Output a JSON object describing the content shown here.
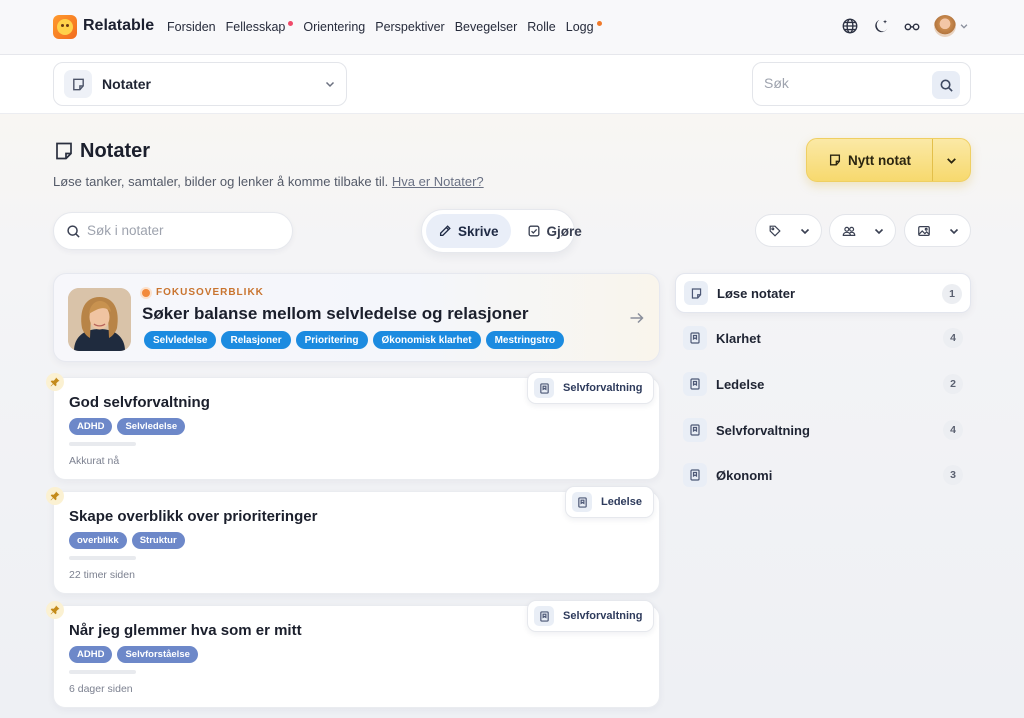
{
  "nav": {
    "brand": "Relatable",
    "links": [
      {
        "label": "Forsiden",
        "dot": ""
      },
      {
        "label": "Fellesskap",
        "dot": "pink"
      },
      {
        "label": "Orientering",
        "dot": ""
      },
      {
        "label": "Perspektiver",
        "dot": ""
      },
      {
        "label": "Bevegelser",
        "dot": ""
      },
      {
        "label": "Rolle",
        "dot": ""
      },
      {
        "label": "Logg",
        "dot": "orange"
      }
    ],
    "icons": [
      "globe-icon",
      "moon-sparkle-icon",
      "glasses-icon"
    ]
  },
  "subheader": {
    "page_select": "Notater",
    "search_placeholder": "Søk"
  },
  "header": {
    "title": "Notater",
    "description": "Løse tanker, samtaler, bilder og lenker å komme tilbake til.",
    "help_link": "Hva er Notater?",
    "new_button": "Nytt notat"
  },
  "filters": {
    "search_placeholder": "Søk i notater",
    "mode_write": "Skrive",
    "mode_do": "Gjøre"
  },
  "focus": {
    "eyebrow": "FOKUSOVERBLIKK",
    "title": "Søker balanse mellom selvledelse og relasjoner",
    "tags": [
      "Selvledelse",
      "Relasjoner",
      "Prioritering",
      "Økonomisk klarhet",
      "Mestringstro"
    ]
  },
  "notes": [
    {
      "title": "God selvforvaltning",
      "tags": [
        "ADHD",
        "Selvledelse"
      ],
      "time": "Akkurat nå",
      "folder": "Selvforvaltning"
    },
    {
      "title": "Skape overblikk over prioriteringer",
      "tags": [
        "overblikk",
        "Struktur"
      ],
      "time": "22 timer siden",
      "folder": "Ledelse"
    },
    {
      "title": "Når jeg glemmer hva som er mitt",
      "tags": [
        "ADHD",
        "Selvforståelse"
      ],
      "time": "6 dager siden",
      "folder": "Selvforvaltning"
    }
  ],
  "folders": [
    {
      "label": "Løse notater",
      "count": "1",
      "icon": "note-icon"
    },
    {
      "label": "Klarhet",
      "count": "4",
      "icon": "bookmark-icon"
    },
    {
      "label": "Ledelse",
      "count": "2",
      "icon": "bookmark-icon"
    },
    {
      "label": "Selvforvaltning",
      "count": "4",
      "icon": "bookmark-icon"
    },
    {
      "label": "Økonomi",
      "count": "3",
      "icon": "bookmark-icon"
    }
  ],
  "colors": {
    "accent_yellow": "#f7d96e",
    "tag_blue": "#1c8be0",
    "tag_slate": "#6d88c9",
    "eyebrow_orange": "#c9742f"
  }
}
